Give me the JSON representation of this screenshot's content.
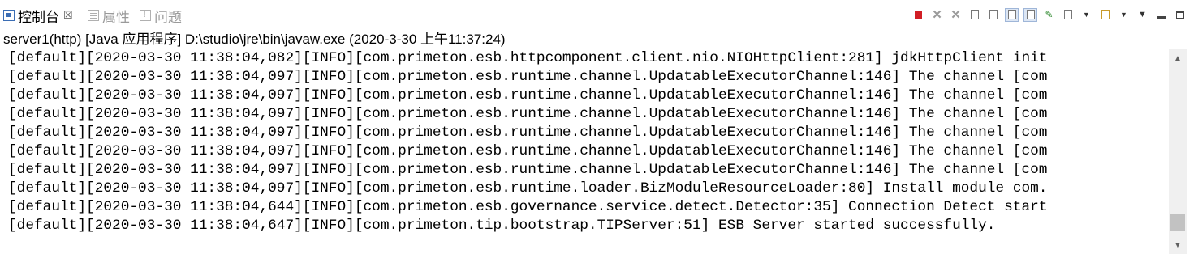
{
  "tabs": [
    {
      "label": "控制台",
      "icon": "console-icon",
      "active": true,
      "close": "☒"
    },
    {
      "label": "属性",
      "icon": "properties-icon",
      "active": false
    },
    {
      "label": "问题",
      "icon": "problems-icon",
      "active": false
    }
  ],
  "toolbar": {
    "icons": [
      "terminate-icon",
      "remove-launch-icon",
      "remove-all-terminated-icon",
      "clear-console-icon",
      "scroll-lock-icon",
      "show-on-stdout-icon",
      "show-on-stderr-icon",
      "pin-console-icon",
      "display-selected-console-icon",
      "open-console-icon",
      "view-menu-icon",
      "minimize-icon",
      "maximize-icon"
    ],
    "accent_red": "#d11e25"
  },
  "description": "server1(http) [Java 应用程序] D:\\studio\\jre\\bin\\javaw.exe  (2020-3-30 上午11:37:24)",
  "console": {
    "lines": [
      "[default][2020-03-30 11:38:04,082][INFO][com.primeton.esb.httpcomponent.client.nio.NIOHttpClient:281] jdkHttpClient init",
      "[default][2020-03-30 11:38:04,097][INFO][com.primeton.esb.runtime.channel.UpdatableExecutorChannel:146] The channel [com",
      "[default][2020-03-30 11:38:04,097][INFO][com.primeton.esb.runtime.channel.UpdatableExecutorChannel:146] The channel [com",
      "[default][2020-03-30 11:38:04,097][INFO][com.primeton.esb.runtime.channel.UpdatableExecutorChannel:146] The channel [com",
      "[default][2020-03-30 11:38:04,097][INFO][com.primeton.esb.runtime.channel.UpdatableExecutorChannel:146] The channel [com",
      "[default][2020-03-30 11:38:04,097][INFO][com.primeton.esb.runtime.channel.UpdatableExecutorChannel:146] The channel [com",
      "[default][2020-03-30 11:38:04,097][INFO][com.primeton.esb.runtime.channel.UpdatableExecutorChannel:146] The channel [com",
      "[default][2020-03-30 11:38:04,097][INFO][com.primeton.esb.runtime.loader.BizModuleResourceLoader:80] Install module com.",
      "[default][2020-03-30 11:38:04,644][INFO][com.primeton.esb.governance.service.detect.Detector:35] Connection Detect start",
      "[default][2020-03-30 11:38:04,647][INFO][com.primeton.tip.bootstrap.TIPServer:51] ESB Server started successfully."
    ]
  },
  "scrollbar": {
    "up": "▲",
    "down": "▼",
    "position_fraction": 1.0
  }
}
